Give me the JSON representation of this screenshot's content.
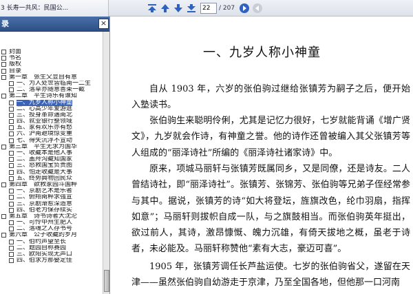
{
  "window": {
    "doc_title": "3 长寿一共风：民国公..."
  },
  "toolbar": {
    "current_page": "22",
    "total_pages": "/ 207",
    "icons": [
      "first-page-icon",
      "previous-page-icon",
      "next-page-icon",
      "last-page-icon",
      "go-icon",
      "back-icon"
    ]
  },
  "sidebar": {
    "title": "录",
    "close_label": "×",
    "items": [
      {
        "label": "封面",
        "level": 0
      },
      {
        "label": "书名",
        "level": 0
      },
      {
        "label": "版权",
        "level": 0
      },
      {
        "label": "目录",
        "level": 0
      },
      {
        "label": "第一章　张生父显自有意",
        "level": 0
      },
      {
        "label": "一、为人处世皆临南一二生",
        "level": 1
      },
      {
        "label": "二、落草亦随意善束一截",
        "level": 1
      },
      {
        "label": "第二章　平生诗乐有谁知",
        "level": 0
      },
      {
        "label": "一、九岁人称小神童",
        "level": 1,
        "selected": true
      },
      {
        "label": "二、心高少年爱游逛",
        "level": 1
      },
      {
        "label": "三、投身革命遇南北",
        "level": 1
      },
      {
        "label": "四、就业银行整领域",
        "level": 1
      },
      {
        "label": "五、家有欢乐亦有愁",
        "level": 1
      },
      {
        "label": "六、沪南避境惊变重",
        "level": 1
      },
      {
        "label": "七、得失沉浮不宣动",
        "level": 1
      },
      {
        "label": "第三章　平生无求为国华",
        "level": 0
      },
      {
        "label": "一、收藏本是他人事",
        "level": 1
      },
      {
        "label": "二、盖舟沟藏知国家",
        "level": 1
      },
      {
        "label": "三、怒救国宝负贵图",
        "level": 1
      },
      {
        "label": "四、怕走收藏是大事",
        "level": 1
      },
      {
        "label": "五、终势典物回民众",
        "level": 1
      },
      {
        "label": "第四章　欲救家园斗国粹",
        "level": 0
      },
      {
        "label": "一、京剧艺术是乐者",
        "level": 1
      },
      {
        "label": "二、俯翔南粹求强宣",
        "level": 1
      },
      {
        "label": "三、京剧渐惹深造意",
        "level": 1
      },
      {
        "label": "四、伯老为保存续实",
        "level": 1
      },
      {
        "label": "第五章　诗书诗者大沈沦",
        "level": 0
      },
      {
        "label": "一、可怜中州生肥人",
        "level": 1
      },
      {
        "label": "二、落魂之人存书号",
        "level": 1
      },
      {
        "label": "第六章　公子收藏的岁月",
        "level": 0
      },
      {
        "label": "一、伯约声望至长",
        "level": 1
      },
      {
        "label": "二、题园自称赛园",
        "level": 1
      },
      {
        "label": "三、欧阳实现无声口",
        "level": 1
      },
      {
        "label": "四、伯求方那娶定佳",
        "level": 1
      }
    ]
  },
  "document": {
    "chapter_title": "一、九岁人称小神童",
    "paragraphs": [
      "自从 1903 年，六岁的张伯驹过继给张镇芳为嗣子之后，便开始入塾读书。",
      "张伯驹生来聪明伶俐，尤其是记忆力很好，七岁就能背诵《增广贤文》，九岁就会作诗，有神童之誉。他的诗作还曾被编入其父张镇芳等人组成的“丽泽诗社”所编的《丽泽诗社诸家诗》中。",
      "原来，项城马丽轩与张镇芳既属同乡，又是同僚，还是诗友。二人曾结诗社，即“丽泽诗社”。张镇芳、张锦芳、张伯驹等兄弟子侄经常参与其中。据说，张镇芳的诗“如大将登坛，旌旗改色，纶巾羽扇，指挥如意”；马丽轩则拔帜自成一队，与之旗鼓相当。而张伯驹英年挺出，欲过前人，其诗，激昂慷慨、魄力沉雄，有倚天拔地之概，虽老于诗者，未必能及。马丽轩称赞他“素有大志，豪迈可喜”。",
      "1905 年，张镇芳调任长芦盐运使。七岁的张伯驹省父，遂留在天津——虽然张伯驹自幼游走于京津，乃至全国各地，但他那一口河南"
    ]
  }
}
